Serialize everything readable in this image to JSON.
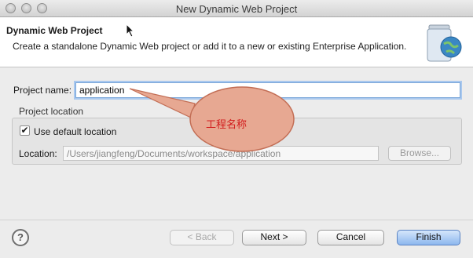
{
  "window": {
    "title": "New Dynamic Web Project"
  },
  "header": {
    "title": "Dynamic Web Project",
    "description": "Create a standalone Dynamic Web project or add it to a new or existing Enterprise Application.",
    "icon": "web-project-jar-globe-icon"
  },
  "form": {
    "project_name_label": "Project name:",
    "project_name_value": "application",
    "location_group_title": "Project location",
    "use_default_label": "Use default location",
    "use_default_checked": true,
    "location_label": "Location:",
    "location_value": "/Users/jiangfeng/Documents/workspace/application",
    "browse_label": "Browse..."
  },
  "annotation": {
    "text": "工程名称",
    "color": "#d21d1d"
  },
  "footer": {
    "help_icon": "?",
    "back_label": "< Back",
    "next_label": "Next >",
    "cancel_label": "Cancel",
    "finish_label": "Finish"
  }
}
